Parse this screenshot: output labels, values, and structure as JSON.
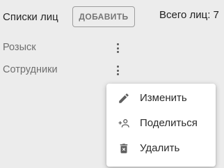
{
  "header": {
    "title": "Списки лиц",
    "add_button_label": "ДОБАВИТЬ",
    "total_text": "Всего лиц: 7"
  },
  "lists": [
    {
      "label": "Розыск",
      "menu_icon": "more-vert-icon"
    },
    {
      "label": "Сотрудники",
      "menu_icon": "more-vert-icon"
    }
  ],
  "context_menu": {
    "items": [
      {
        "label": "Изменить",
        "icon": "edit-icon"
      },
      {
        "label": "Поделиться",
        "icon": "person-add-icon"
      },
      {
        "label": "Удалить",
        "icon": "delete-icon"
      }
    ]
  },
  "colors": {
    "background": "#ececec",
    "menu_background": "#ffffff",
    "icon": "#5a5a5a"
  }
}
